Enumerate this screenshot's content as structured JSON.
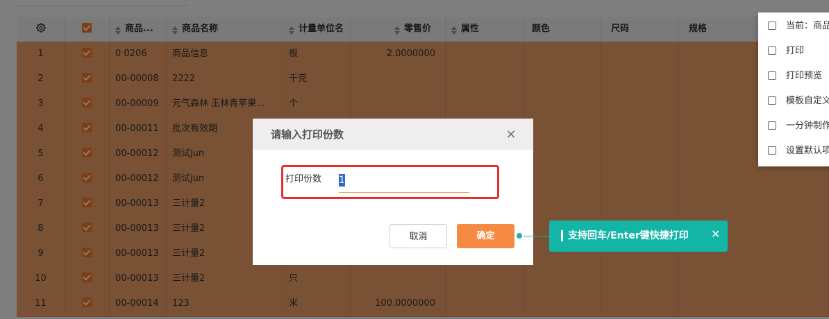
{
  "table": {
    "columns": [
      {
        "name": "gear",
        "label": "",
        "sortable": false
      },
      {
        "name": "checkbox",
        "label": "",
        "sortable": false
      },
      {
        "name": "code",
        "label": "商品...",
        "sortable": true
      },
      {
        "name": "product-name",
        "label": "商品名称",
        "sortable": true
      },
      {
        "name": "unit",
        "label": "计量单位名",
        "sortable": true
      },
      {
        "name": "price",
        "label": "零售价",
        "sortable": true
      },
      {
        "name": "attribute",
        "label": "属性",
        "sortable": true
      },
      {
        "name": "color",
        "label": "颜色",
        "sortable": false
      },
      {
        "name": "size",
        "label": "尺码",
        "sortable": false
      },
      {
        "name": "spec",
        "label": "规格",
        "sortable": false
      }
    ],
    "rows": [
      {
        "index": "1",
        "code": "0 0206",
        "name": "商品信息",
        "unit": "根",
        "price": "2.0000000"
      },
      {
        "index": "2",
        "code": "00-00008",
        "name": "2222",
        "unit": "千克",
        "price": ""
      },
      {
        "index": "3",
        "code": "00-00009",
        "name": "元气森林 王林青苹果...",
        "unit": "个",
        "price": ""
      },
      {
        "index": "4",
        "code": "00-00011",
        "name": "批次有效期",
        "unit": "",
        "price": ""
      },
      {
        "index": "5",
        "code": "00-00012",
        "name": "测试jun",
        "unit": "",
        "price": ""
      },
      {
        "index": "6",
        "code": "00-00012",
        "name": "测试jun",
        "unit": "",
        "price": ""
      },
      {
        "index": "7",
        "code": "00-00013",
        "name": "三计量2",
        "unit": "",
        "price": ""
      },
      {
        "index": "8",
        "code": "00-00013",
        "name": "三计量2",
        "unit": "",
        "price": ""
      },
      {
        "index": "9",
        "code": "00-00013",
        "name": "三计量2",
        "unit": "",
        "price": ""
      },
      {
        "index": "10",
        "code": "00-00013",
        "name": "三计量2",
        "unit": "只",
        "price": ""
      },
      {
        "index": "11",
        "code": "00-00014",
        "name": "123",
        "unit": "米",
        "price": "100.0000000"
      }
    ]
  },
  "print_menu": {
    "items": [
      {
        "name": "current-template",
        "label": "当前：商品"
      },
      {
        "name": "print",
        "label": "打印"
      },
      {
        "name": "print-preview",
        "label": "打印预览"
      },
      {
        "name": "custom-template",
        "label": "模板自定义"
      },
      {
        "name": "one-minute-make",
        "label": "一分钟制作"
      },
      {
        "name": "set-default",
        "label": "设置默认项"
      }
    ]
  },
  "dialog": {
    "title": "请输入打印份数",
    "close_symbol": "×",
    "field_label": "打印份数",
    "field_value": "1",
    "cancel_label": "取消",
    "ok_label": "确定"
  },
  "tooltip": {
    "text": "支持回车/Enter键快捷打印",
    "close_symbol": "✕"
  },
  "colors": {
    "row_highlight": "#f3a46a",
    "checkbox": "#ff7a22",
    "ok_button": "#f58a45",
    "tooltip": "#13b5a7",
    "field_border": "#e23030"
  }
}
